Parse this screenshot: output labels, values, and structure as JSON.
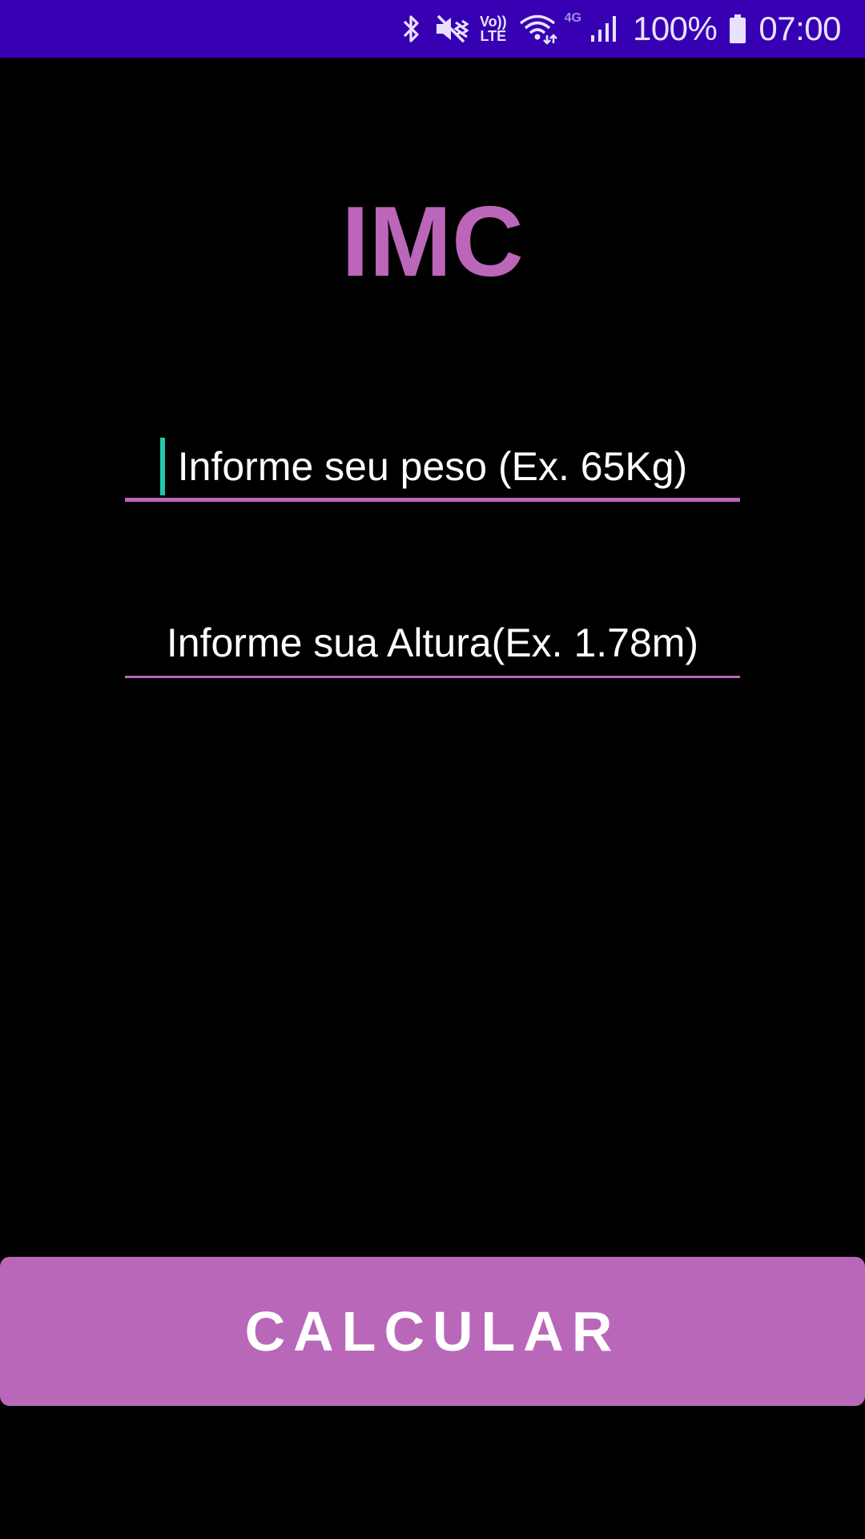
{
  "status_bar": {
    "icons": [
      "bluetooth-icon",
      "vibrate-mute-icon",
      "volte-icon",
      "wifi-icon",
      "network-4g-icon",
      "signal-icon",
      "battery-icon"
    ],
    "volte_top": "Vo))",
    "volte_bottom": "LTE",
    "network_type": "4G",
    "battery_percent": "100%",
    "time": "07:00",
    "background_color": "#3700b3"
  },
  "app": {
    "title": "IMC",
    "title_color": "#bb66b8"
  },
  "form": {
    "weight_placeholder": "Informe seu peso (Ex. 65Kg)",
    "height_placeholder": "Informe sua Altura(Ex. 1.78m)",
    "underline_color": "#bb66b8",
    "cursor_color": "#1fc9a7"
  },
  "actions": {
    "calculate_label": "CALCULAR",
    "button_color": "#b967b8"
  }
}
